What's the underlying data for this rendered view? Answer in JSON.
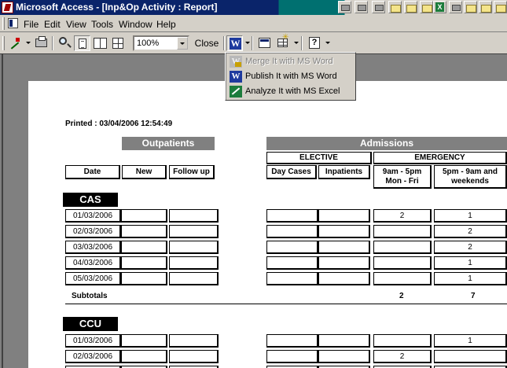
{
  "window": {
    "title": "Microsoft Access - [Inp&Op Activity : Report]"
  },
  "menu": {
    "items": [
      "File",
      "Edit",
      "View",
      "Tools",
      "Window",
      "Help"
    ]
  },
  "toolbar": {
    "zoom_value": "100%",
    "close_label": "Close"
  },
  "ms_office_menu": {
    "items": [
      {
        "label": "Merge It with MS Word",
        "enabled": false,
        "icon": "word-merge-icon"
      },
      {
        "label": "Publish It with MS Word",
        "enabled": true,
        "icon": "word-icon"
      },
      {
        "label": "Analyze It with MS Excel",
        "enabled": true,
        "icon": "excel-icon"
      }
    ]
  },
  "report": {
    "printed": "Printed : 03/04/2006 12:54:49",
    "outpatients_label": "Outpatients",
    "admissions_label": "Admissions",
    "elective_label": "ELECTIVE",
    "emergency_label": "EMERGENCY",
    "headers": {
      "date": "Date",
      "new": "New",
      "follow_up": "Follow up",
      "day_cases": "Day Cases",
      "inpatients": "Inpatients",
      "em_day": "9am - 5pm Mon - Fri",
      "em_evening": "5pm - 9am and weekends"
    },
    "sections": [
      {
        "name": "CAS",
        "rows": [
          {
            "date": "01/03/2006",
            "new": "",
            "follow_up": "",
            "day_cases": "",
            "inpatients": "",
            "em_day": "2",
            "em_evening": "1"
          },
          {
            "date": "02/03/2006",
            "new": "",
            "follow_up": "",
            "day_cases": "",
            "inpatients": "",
            "em_day": "",
            "em_evening": "2"
          },
          {
            "date": "03/03/2006",
            "new": "",
            "follow_up": "",
            "day_cases": "",
            "inpatients": "",
            "em_day": "",
            "em_evening": "2"
          },
          {
            "date": "04/03/2006",
            "new": "",
            "follow_up": "",
            "day_cases": "",
            "inpatients": "",
            "em_day": "",
            "em_evening": "1"
          },
          {
            "date": "05/03/2006",
            "new": "",
            "follow_up": "",
            "day_cases": "",
            "inpatients": "",
            "em_day": "",
            "em_evening": "1"
          }
        ],
        "subtotals_label": "Subtotals",
        "subtotals": {
          "em_day": "2",
          "em_evening": "7"
        }
      },
      {
        "name": "CCU",
        "rows": [
          {
            "date": "01/03/2006",
            "new": "",
            "follow_up": "",
            "day_cases": "",
            "inpatients": "",
            "em_day": "",
            "em_evening": "1"
          },
          {
            "date": "02/03/2006",
            "new": "",
            "follow_up": "",
            "day_cases": "",
            "inpatients": "",
            "em_day": "2",
            "em_evening": ""
          }
        ]
      }
    ]
  }
}
